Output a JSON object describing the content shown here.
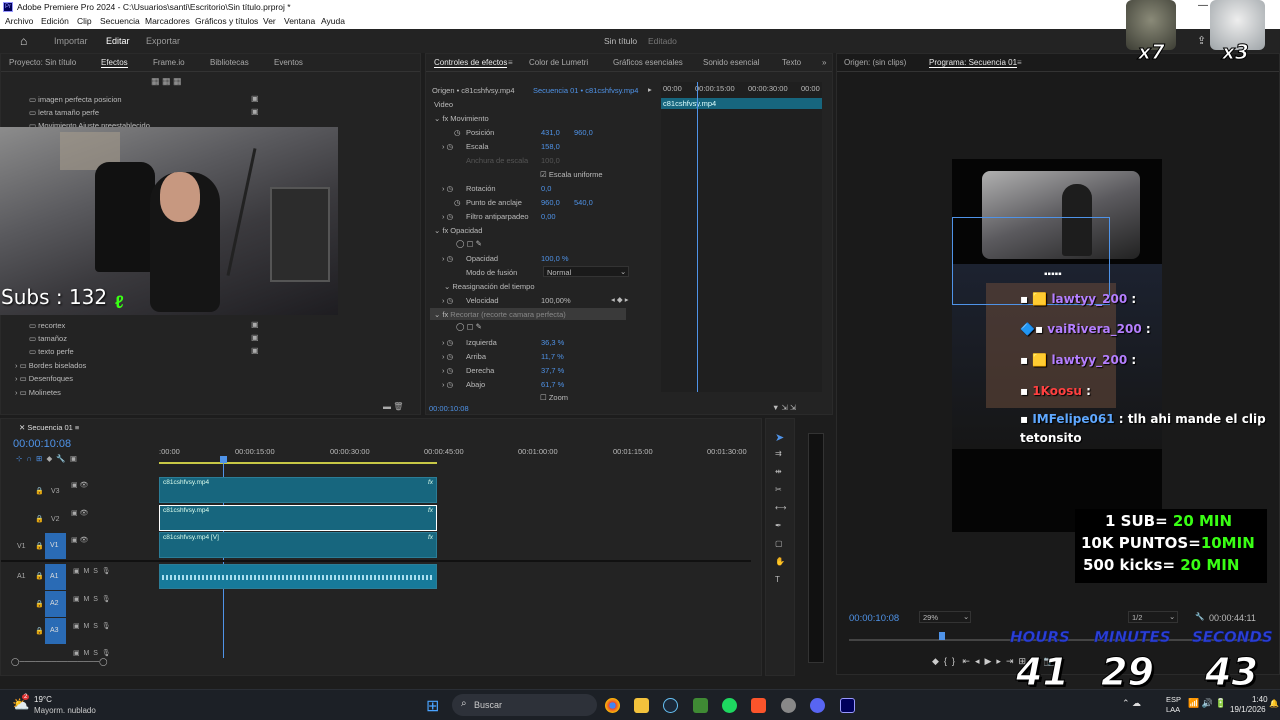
{
  "window": {
    "title": "Adobe Premiere Pro 2024 - C:\\Usuarios\\santi\\Escritorio\\Sin título.prproj *"
  },
  "menu": [
    "Archivo",
    "Edición",
    "Clip",
    "Secuencia",
    "Marcadores",
    "Gráficos y títulos",
    "Ver",
    "Ventana",
    "Ayuda"
  ],
  "workspace": {
    "tabs": [
      "Importar",
      "Editar",
      "Exportar"
    ],
    "active": "Editar",
    "project_title": "Sin título",
    "project_status": "Editado"
  },
  "left_panel": {
    "tabs": [
      "Proyecto: Sin título",
      "Efectos",
      "Frame.io",
      "Bibliotecas",
      "Eventos"
    ],
    "presets": [
      "imagen perfecta posicion",
      "letra tamaño perfe",
      "Movimiento Ajuste preestablecido"
    ],
    "items": [
      "recortex",
      "tamañoz",
      "texto perfe",
      "Bordes biselados",
      "Desenfoques",
      "Molinetes"
    ]
  },
  "webcam_overlay": {
    "subs_text": "Subs : 132"
  },
  "effect_controls": {
    "tabs": [
      "Controles de efectos",
      "Color de Lumetri",
      "Gráficos esenciales",
      "Sonido esencial",
      "Texto"
    ],
    "source": "Origen • c81cshfvsy.mp4",
    "sequence": "Secuencia 01 • c81cshfvsy.mp4",
    "ruler": [
      "00:00",
      "00:00:15:00",
      "00:00:30:00",
      "00:00"
    ],
    "clip_name": "c81cshfvsy.mp4",
    "section_video": "Video",
    "motion": "Movimiento",
    "position": {
      "label": "Posición",
      "x": "431,0",
      "y": "960,0"
    },
    "scale": {
      "label": "Escala",
      "value": "158,0"
    },
    "scale_width": {
      "label": "Anchura de escala",
      "value": "100,0"
    },
    "uniform": "Escala uniforme",
    "rotation": {
      "label": "Rotación",
      "value": "0,0"
    },
    "anchor": {
      "label": "Punto de anclaje",
      "x": "960,0",
      "y": "540,0"
    },
    "flicker": {
      "label": "Filtro antiparpadeo",
      "value": "0,00"
    },
    "opacity_section": "Opacidad",
    "opacity": {
      "label": "Opacidad",
      "value": "100,0 %"
    },
    "blend": {
      "label": "Modo de fusión",
      "value": "Normal"
    },
    "time_remap": "Reasignación del tiempo",
    "speed": {
      "label": "Velocidad",
      "value": "100,00%"
    },
    "crop_section": "Recortar (recorte camara perfecta)",
    "left": {
      "label": "Izquierda",
      "value": "36,3 %"
    },
    "top": {
      "label": "Arriba",
      "value": "11,7 %"
    },
    "right": {
      "label": "Derecha",
      "value": "37,7 %"
    },
    "bottom": {
      "label": "Abajo",
      "value": "61,7 %"
    },
    "zoom": "Zoom",
    "timecode": "00:00:10:08"
  },
  "program": {
    "tabs": [
      "Origen: (sin clips)",
      "Programa: Secuencia 01"
    ],
    "timecode": "00:00:10:08",
    "zoom": "29%",
    "quality": "1/2",
    "duration": "00:00:44:11",
    "badge_left": "x7",
    "badge_right": "x3"
  },
  "chat": [
    {
      "user": "lawtyy_200",
      "msg": ":"
    },
    {
      "user": "vaiRivera_200",
      "msg": ":"
    },
    {
      "user": "lawtyy_200",
      "msg": ":"
    },
    {
      "user": "1Koosu",
      "msg": ":"
    },
    {
      "user": "IMFelipe061",
      "msg": ": tlh ahi mande el clip"
    },
    {
      "user": "",
      "msg": "tetonsito"
    }
  ],
  "rules": [
    {
      "left": "1 SUB=",
      "right": "20 MIN"
    },
    {
      "left": "10K PUNTOS=",
      "right": "10MIN"
    },
    {
      "left": "500 kicks=",
      "right": "20 MIN"
    }
  ],
  "timer": {
    "labels": [
      "HOURS",
      "MINUTES",
      "SECONDS"
    ],
    "values": [
      "41",
      "29",
      "43"
    ]
  },
  "timeline": {
    "tab": "Secuencia 01",
    "timecode": "00:00:10:08",
    "ruler": [
      ":00:00",
      "00:00:15:00",
      "00:00:30:00",
      "00:00:45:00",
      "00:01:00:00",
      "00:01:15:00",
      "00:01:30:00"
    ],
    "tracks": [
      "V3",
      "V2",
      "V1",
      "A1",
      "A2",
      "A3"
    ],
    "clips": [
      "c81cshfvsy.mp4",
      "c81cshfvsy.mp4",
      "c81cshfvsy.mp4 [V]"
    ],
    "audio_btns": [
      "M",
      "S"
    ],
    "src_label": "V1",
    "src_a_label": "A1"
  },
  "taskbar": {
    "weather_temp": "19°C",
    "weather_desc": "Mayorm. nublado",
    "search": "Buscar",
    "lang1": "ESP",
    "lang2": "LAA",
    "time": "1:40",
    "date": "19/1/2026",
    "notif_badge": "2"
  },
  "colors": {
    "accent": "#4f93e8",
    "clip": "#17667e",
    "green": "#39ff14"
  }
}
